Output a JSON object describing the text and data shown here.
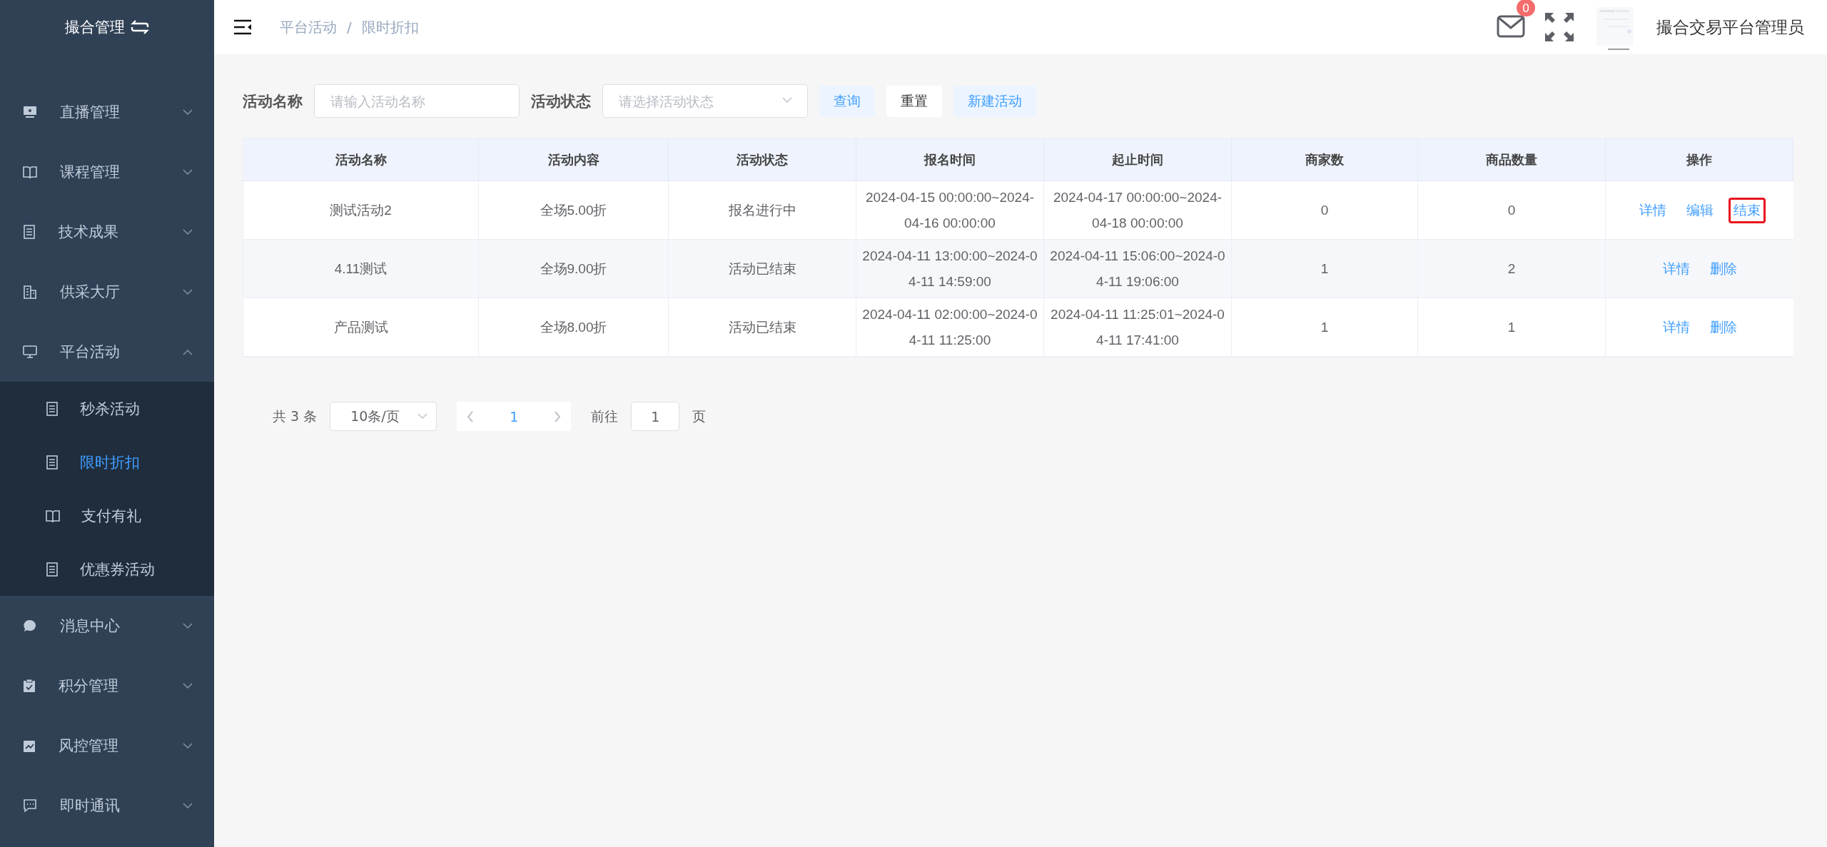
{
  "sidebar": {
    "title": "撮合管理",
    "items": [
      {
        "label": "直播管理",
        "expanded": false
      },
      {
        "label": "课程管理",
        "expanded": false
      },
      {
        "label": "技术成果",
        "expanded": false
      },
      {
        "label": "供采大厅",
        "expanded": false
      },
      {
        "label": "平台活动",
        "expanded": true,
        "children": [
          {
            "label": "秒杀活动",
            "selected": false
          },
          {
            "label": "限时折扣",
            "selected": true
          },
          {
            "label": "支付有礼",
            "selected": false
          },
          {
            "label": "优惠券活动",
            "selected": false
          }
        ]
      },
      {
        "label": "消息中心",
        "expanded": false
      },
      {
        "label": "积分管理",
        "expanded": false
      },
      {
        "label": "风控管理",
        "expanded": false
      },
      {
        "label": "即时通讯",
        "expanded": false
      }
    ]
  },
  "header": {
    "breadcrumb": [
      "平台活动",
      "限时折扣"
    ],
    "separator": "/",
    "mail_badge": "0",
    "user_name": "撮合交易平台管理员"
  },
  "filters": {
    "fields": [
      {
        "label": "活动名称",
        "kind": "input",
        "placeholder": "请输入活动名称"
      },
      {
        "label": "活动状态",
        "kind": "select",
        "placeholder": "请选择活动状态"
      }
    ],
    "buttons": [
      {
        "label": "查询",
        "kind": "primary"
      },
      {
        "label": "重置",
        "kind": "default"
      },
      {
        "label": "新建活动",
        "kind": "primary"
      }
    ]
  },
  "table": {
    "columns": [
      "活动名称",
      "活动内容",
      "活动状态",
      "报名时间",
      "起止时间",
      "商家数",
      "商品数量",
      "操作"
    ],
    "rows": [
      {
        "cells": [
          "测试活动2",
          "全场5.00折",
          "报名进行中",
          "2024-04-15 00:00:00~2024-04-16 00:00:00",
          "2024-04-17 00:00:00~2024-04-18 00:00:00",
          "0",
          "0"
        ],
        "actions": [
          {
            "label": "详情",
            "highlighted": false
          },
          {
            "label": "编辑",
            "highlighted": false
          },
          {
            "label": "结束",
            "highlighted": true
          }
        ]
      },
      {
        "cells": [
          "4.11测试",
          "全场9.00折",
          "活动已结束",
          "2024-04-11 13:00:00~2024-04-11 14:59:00",
          "2024-04-11 15:06:00~2024-04-11 19:06:00",
          "1",
          "2"
        ],
        "actions": [
          {
            "label": "详情",
            "highlighted": false
          },
          {
            "label": "删除",
            "highlighted": false
          }
        ]
      },
      {
        "cells": [
          "产品测试",
          "全场8.00折",
          "活动已结束",
          "2024-04-11 02:00:00~2024-04-11 11:25:00",
          "2024-04-11 11:25:01~2024-04-11 17:41:00",
          "1",
          "1"
        ],
        "actions": [
          {
            "label": "详情",
            "highlighted": false
          },
          {
            "label": "删除",
            "highlighted": false
          }
        ]
      }
    ]
  },
  "pagination": {
    "total": "共 3 条",
    "page_size": "10条/页",
    "current_page": "1",
    "goto_label": "前往",
    "goto_value": "1",
    "goto_suffix": "页"
  }
}
